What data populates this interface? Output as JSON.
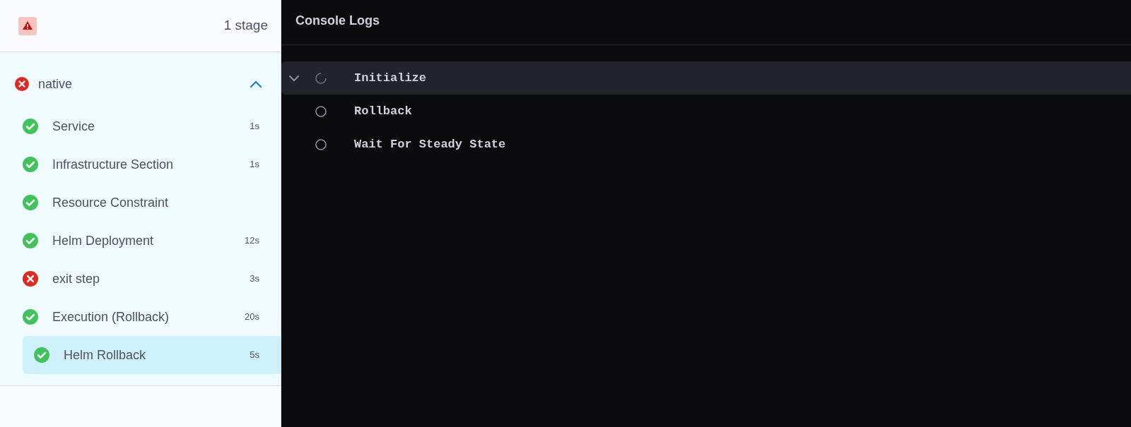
{
  "summary": {
    "failed": true,
    "count": "1 stage"
  },
  "stage": {
    "name": "native",
    "failed": true,
    "expanded": true,
    "steps": [
      {
        "name": "Service",
        "failed": false,
        "duration": "1s",
        "selected": false
      },
      {
        "name": "Infrastructure Section",
        "failed": false,
        "duration": "1s",
        "selected": false
      },
      {
        "name": "Resource Constraint",
        "failed": false,
        "selected": false
      },
      {
        "name": "Helm Deployment",
        "failed": false,
        "duration": "12s",
        "selected": false
      },
      {
        "name": "exit step",
        "failed": true,
        "duration": "3s",
        "selected": false
      },
      {
        "name": "Execution (Rollback)",
        "failed": false,
        "duration": "20s",
        "selected": false,
        "children": [
          {
            "name": "Helm Rollback",
            "failed": false,
            "duration": "5s",
            "selected": true
          }
        ]
      }
    ]
  },
  "console": {
    "title": "Console Logs",
    "units": [
      {
        "name": "Initialize",
        "running": true,
        "selected": true
      },
      {
        "name": "Rollback",
        "running": false,
        "selected": false
      },
      {
        "name": "Wait For Steady State",
        "running": false,
        "selected": false
      }
    ]
  }
}
